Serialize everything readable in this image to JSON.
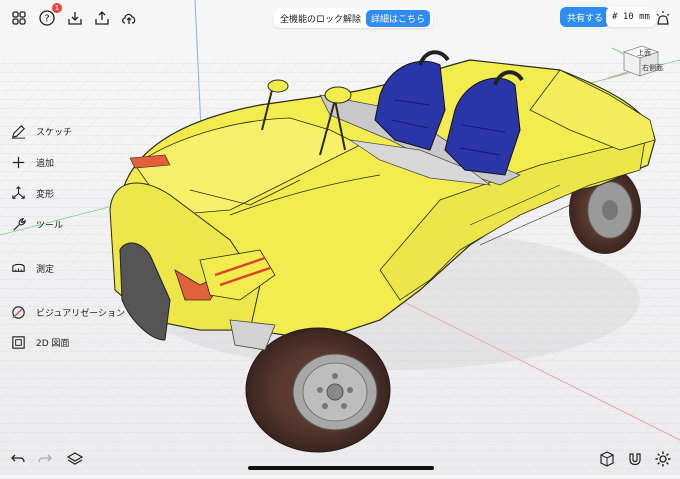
{
  "toolbar": {
    "notification_count": "1",
    "unlock_label": "全機能のロック解除",
    "details_label": "詳細はこちら",
    "share_label": "共有する",
    "grid_label": "# 10 mm"
  },
  "viewcube": {
    "top_label": "上面",
    "right_label": "右側面"
  },
  "sidebar": {
    "items": [
      {
        "label": "スケッチ",
        "icon": "pencil-icon"
      },
      {
        "label": "追加",
        "icon": "plus-icon"
      },
      {
        "label": "変形",
        "icon": "transform-icon"
      },
      {
        "label": "ツール",
        "icon": "wrench-icon"
      },
      {
        "label": "測定",
        "icon": "ruler-icon"
      },
      {
        "label": "ビジュアリゼーション",
        "icon": "visualization-icon"
      },
      {
        "label": "2D 図面",
        "icon": "drawing-icon"
      }
    ]
  },
  "colors": {
    "accent": "#2f8cf0",
    "car_body": "#f2ec4e",
    "seat": "#2a36a8",
    "notification": "#e8453c"
  }
}
